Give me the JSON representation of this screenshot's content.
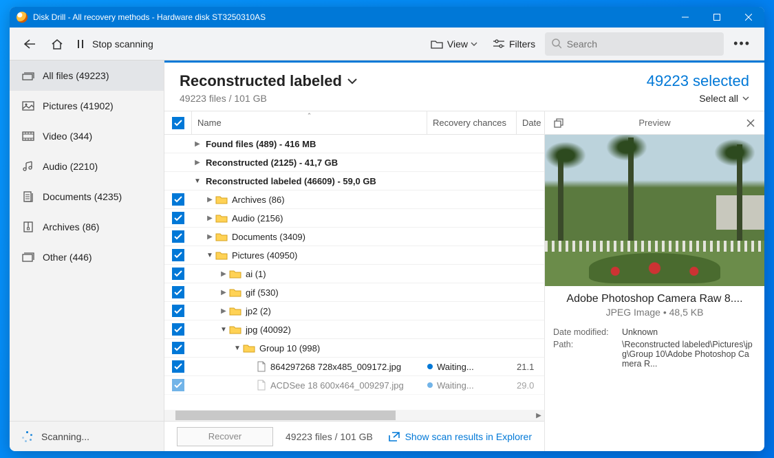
{
  "titlebar": {
    "text": "Disk Drill - All recovery methods - Hardware disk ST3250310AS"
  },
  "toolbar": {
    "stop_label": "Stop scanning",
    "view_label": "View",
    "filters_label": "Filters",
    "search_placeholder": "Search"
  },
  "sidebar": {
    "items": [
      {
        "label": "All files (49223)"
      },
      {
        "label": "Pictures (41902)"
      },
      {
        "label": "Video (344)"
      },
      {
        "label": "Audio (2210)"
      },
      {
        "label": "Documents (4235)"
      },
      {
        "label": "Archives (86)"
      },
      {
        "label": "Other (446)"
      }
    ],
    "status_label": "Scanning..."
  },
  "header": {
    "title": "Reconstructed labeled",
    "subtitle": "49223 files / 101 GB",
    "selected": "49223 selected",
    "select_all": "Select all"
  },
  "columns": {
    "name": "Name",
    "recovery": "Recovery chances",
    "date": "Date"
  },
  "rows": [
    {
      "text": "Found files (489) - 416 MB"
    },
    {
      "text": "Reconstructed (2125) - 41,7 GB"
    },
    {
      "text": "Reconstructed labeled (46609) - 59,0 GB"
    },
    {
      "text": "Archives (86)"
    },
    {
      "text": "Audio (2156)"
    },
    {
      "text": "Documents (3409)"
    },
    {
      "text": "Pictures (40950)"
    },
    {
      "text": "ai (1)"
    },
    {
      "text": "gif (530)"
    },
    {
      "text": "jp2 (2)"
    },
    {
      "text": "jpg (40092)"
    },
    {
      "text": "Group 10 (998)"
    },
    {
      "text": "864297268 728x485_009172.jpg",
      "rec": "Waiting...",
      "date": "21.1"
    },
    {
      "text": "ACDSee 18 600x464_009297.jpg",
      "rec": "Waiting...",
      "date": "29.0"
    }
  ],
  "preview": {
    "title": "Preview",
    "name": "Adobe Photoshop Camera Raw 8....",
    "meta": "JPEG Image • 48,5 KB",
    "date_modified_label": "Date modified:",
    "date_modified_value": "Unknown",
    "path_label": "Path:",
    "path_value": "\\Reconstructed labeled\\Pictures\\jpg\\Group 10\\Adobe Photoshop Camera R..."
  },
  "footer": {
    "recover": "Recover",
    "summary": "49223 files / 101 GB",
    "explorer": "Show scan results in Explorer"
  }
}
